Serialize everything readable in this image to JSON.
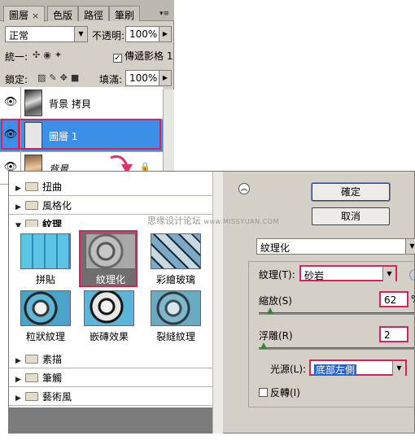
{
  "layers_panel": {
    "tabs": [
      {
        "label": "圖層",
        "close": "×"
      },
      {
        "label": "色版"
      },
      {
        "label": "路徑"
      },
      {
        "label": "筆刷"
      }
    ],
    "menu_glyph": "▾≡",
    "blend_mode": "正常",
    "opacity_label": "不透明:",
    "opacity_value": "100%",
    "unify_label": "統一:",
    "propagate_label": "傳遞影格 1",
    "lock_label": "鎖定:",
    "fill_label": "填滿:",
    "fill_value": "100%",
    "layers": [
      {
        "name": "背景 拷貝",
        "visible": true
      },
      {
        "name": "圖層 1",
        "visible": true,
        "selected": true
      },
      {
        "name": "背景",
        "visible": true,
        "locked": true
      }
    ]
  },
  "filter_dialog": {
    "categories_top": [
      {
        "name": "扭曲",
        "open": false
      },
      {
        "name": "風格化",
        "open": false
      },
      {
        "name": "紋理",
        "open": true
      }
    ],
    "texture_filters": [
      {
        "name": "拼貼"
      },
      {
        "name": "紋理化",
        "selected": true
      },
      {
        "name": "彩繪玻璃"
      },
      {
        "name": "粒狀紋理"
      },
      {
        "name": "嵌磚效果"
      },
      {
        "name": "裂縫紋理"
      }
    ],
    "categories_bottom": [
      {
        "name": "素描",
        "open": false
      },
      {
        "name": "筆觸",
        "open": false
      },
      {
        "name": "藝術風",
        "open": false
      }
    ],
    "ok_label": "確定",
    "cancel_label": "取消",
    "watermark": "思缘设计论坛",
    "watermark_url": "www.MISSYUAN.COM",
    "filter_select": "紋理化",
    "texture_label": "紋理(T):",
    "texture_value": "砂岩",
    "scale_label": "縮放(S)",
    "scale_value": "62",
    "scale_unit": "%",
    "relief_label": "浮雕(R)",
    "relief_value": "2",
    "light_label": "光源(L):",
    "light_value": "底部左側",
    "invert_label": "反轉(I)",
    "invert_checked": false,
    "colors": {
      "highlight": "#d4245e",
      "selection": "#3c8fe6"
    }
  }
}
